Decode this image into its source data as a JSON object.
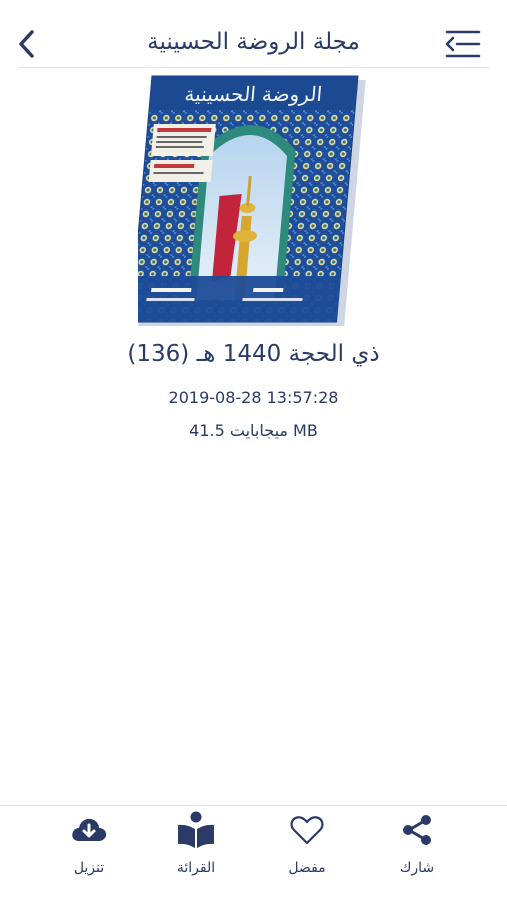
{
  "header": {
    "title": "مجلة الروضة الحسينية",
    "back_icon": "chevron-left-icon",
    "menu_icon": "menu-icon"
  },
  "issue": {
    "title": "(136) ذي الحجة 1440 هـ",
    "date": "2019-08-28 13:57:28",
    "size": "ميجابايت 41.5 MB",
    "cover_icon": "magazine-cover-image"
  },
  "tabbar": {
    "download": {
      "label": "تنزيل",
      "icon": "cloud-download-icon"
    },
    "read": {
      "label": "القرائة",
      "icon": "book-reader-icon"
    },
    "favorite": {
      "label": "مفضل",
      "icon": "heart-icon"
    },
    "share": {
      "label": "شارك",
      "icon": "share-icon"
    }
  },
  "colors": {
    "primary": "#2b3a67",
    "divider": "#dfe3ea",
    "cover_blue": "#1f4f9c"
  }
}
